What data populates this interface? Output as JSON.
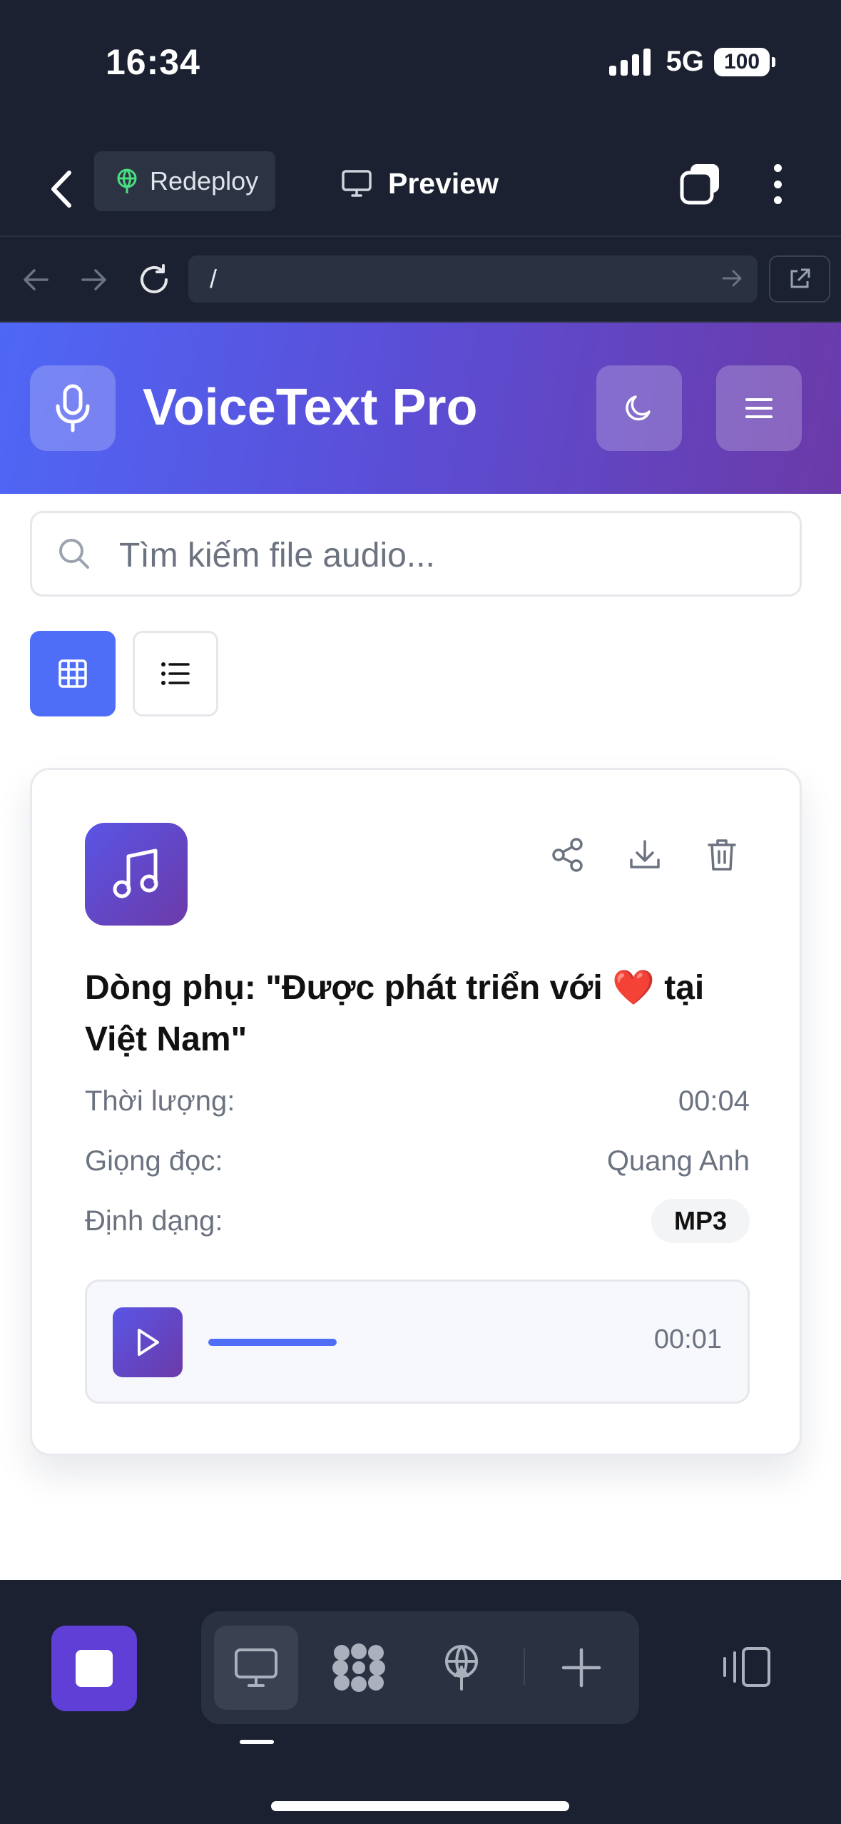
{
  "status_bar": {
    "time": "16:34",
    "network": "5G",
    "battery": "100"
  },
  "browser": {
    "redeploy_label": "Redeploy",
    "preview_label": "Preview",
    "url_path": "/"
  },
  "app": {
    "title": "VoiceText Pro",
    "search_placeholder": "Tìm kiếm file audio...",
    "accent_color": "#4f6ef7"
  },
  "card": {
    "title": "Dòng phụ: \"Được phát triển với",
    "title_emoji": "❤️",
    "title_rest": "tại Việt Nam\"",
    "duration_label": "Thời lượng:",
    "duration_value": "00:04",
    "voice_label": "Giọng đọc:",
    "voice_value": "Quang Anh",
    "format_label": "Định dạng:",
    "format_value": "MP3",
    "player_time": "00:01",
    "progress_fraction": 0.25
  },
  "icons": {
    "header": [
      "microphone-icon",
      "moon-icon",
      "menu-icon"
    ],
    "card_actions": [
      "share-icon",
      "download-icon",
      "trash-icon"
    ],
    "bottom_toolbar": [
      "desktop-icon",
      "apps-icon",
      "deploy-icon",
      "plus-icon",
      "split-view-icon"
    ]
  }
}
